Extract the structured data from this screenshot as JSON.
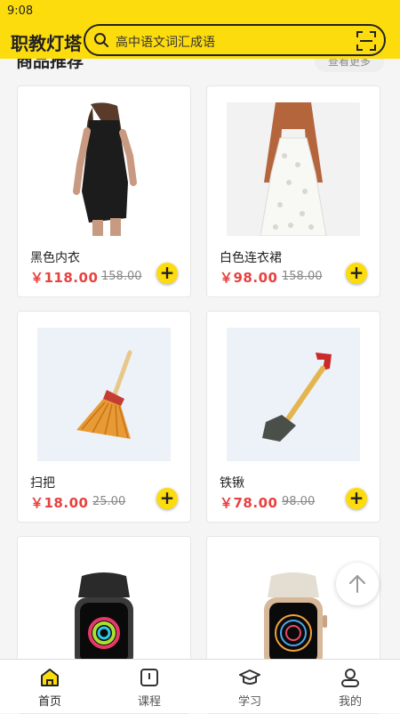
{
  "status_bar": {
    "time": "9:08"
  },
  "header": {
    "brand": "职教灯塔",
    "search_placeholder": "高中语文词汇成语"
  },
  "section": {
    "title": "商品推荐",
    "more_label": "查看更多"
  },
  "products": [
    {
      "name": "黑色内衣",
      "price": "￥118.00",
      "original_price": "158.00"
    },
    {
      "name": "白色连衣裙",
      "price": "￥98.00",
      "original_price": "158.00"
    },
    {
      "name": "扫把",
      "price": "￥18.00",
      "original_price": "25.00"
    },
    {
      "name": "铁锹",
      "price": "￥78.00",
      "original_price": "98.00"
    }
  ],
  "tabbar": [
    {
      "label": "首页",
      "icon": "home-icon",
      "active": true
    },
    {
      "label": "课程",
      "icon": "book-icon",
      "active": false
    },
    {
      "label": "学习",
      "icon": "graduation-cap-icon",
      "active": false
    },
    {
      "label": "我的",
      "icon": "user-icon",
      "active": false
    }
  ],
  "colors": {
    "accent": "#fddc0e",
    "price": "#e8413f"
  }
}
